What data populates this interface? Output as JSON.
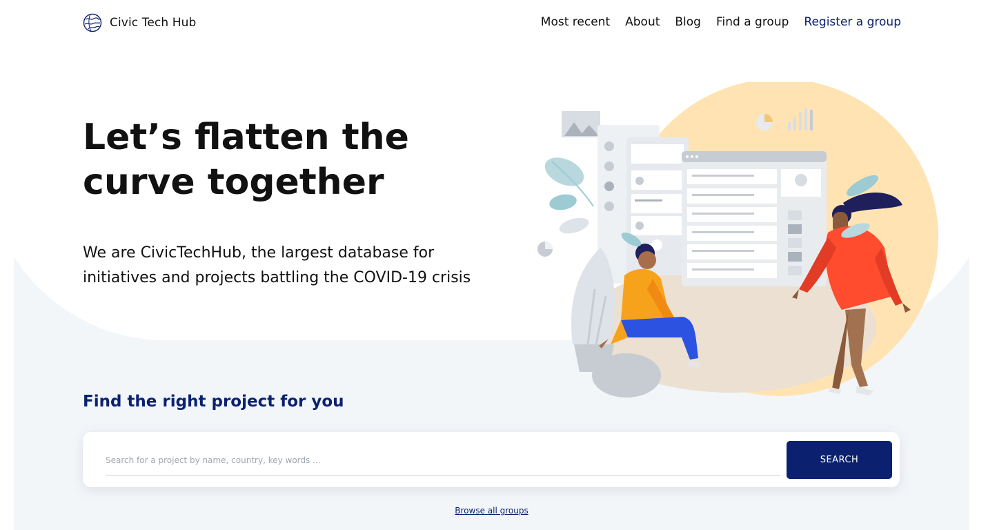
{
  "header": {
    "brand_name": "Civic Tech Hub",
    "nav": [
      {
        "label": "Most recent"
      },
      {
        "label": "About"
      },
      {
        "label": "Blog"
      },
      {
        "label": "Find a group"
      },
      {
        "label": "Register a group"
      }
    ]
  },
  "hero": {
    "title": "Let’s flatten the curve together",
    "subtitle": "We are CivicTechHub, the largest database for initiatives and projects battling the COVID-19 crisis"
  },
  "search": {
    "heading": "Find the right project for you",
    "placeholder": "Search for a project by name, country, key words ...",
    "value": "",
    "button_label": "SEARCH",
    "browse_label": "Browse all groups"
  },
  "colors": {
    "brand": "#0b2170",
    "background": "#f3f6f9",
    "accent_circle": "#ffe3b3"
  },
  "icons": {
    "logo": "globe-logo-icon"
  }
}
